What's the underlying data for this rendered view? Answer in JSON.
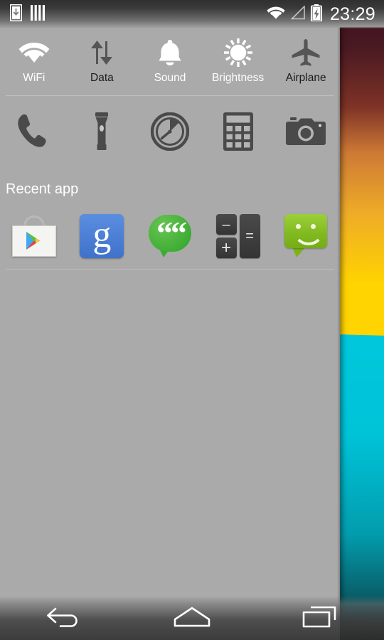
{
  "statusbar": {
    "left_icons": [
      {
        "name": "download-icon",
        "label": "Download"
      },
      {
        "name": "sim-card-icon",
        "label": "SIM"
      }
    ],
    "right_icons": [
      {
        "name": "wifi-icon",
        "label": "WiFi signal"
      },
      {
        "name": "cell-signal-icon",
        "label": "Mobile signal"
      },
      {
        "name": "battery-charging-icon",
        "label": "Battery charging"
      }
    ],
    "clock": "23:29"
  },
  "toggles": [
    {
      "label": "WiFi",
      "icon": "wifi-icon",
      "state": "on"
    },
    {
      "label": "Data",
      "icon": "data-sync-icon",
      "state": "off"
    },
    {
      "label": "Sound",
      "icon": "bell-icon",
      "state": "on"
    },
    {
      "label": "Brightness",
      "icon": "sun-icon",
      "state": "on"
    },
    {
      "label": "Airplane",
      "icon": "airplane-icon",
      "state": "off"
    }
  ],
  "shortcuts": [
    {
      "label": "Phone",
      "icon": "phone-icon"
    },
    {
      "label": "Flashlight",
      "icon": "flashlight-icon"
    },
    {
      "label": "Timer",
      "icon": "timer-icon"
    },
    {
      "label": "Calculator",
      "icon": "calculator-icon"
    },
    {
      "label": "Camera",
      "icon": "camera-icon"
    }
  ],
  "recent": {
    "title": "Recent app",
    "apps": [
      {
        "label": "Play Store",
        "icon": "play-store-icon"
      },
      {
        "label": "Google",
        "icon": "google-search-icon",
        "glyph": "g"
      },
      {
        "label": "Hangouts",
        "icon": "hangouts-icon",
        "glyph_left": "“",
        "glyph_right": "“"
      },
      {
        "label": "Calculator",
        "icon": "calculator-app-icon",
        "key_minus": "–",
        "key_plus": "+",
        "key_equals": "="
      },
      {
        "label": "Messaging",
        "icon": "messaging-icon"
      }
    ]
  },
  "navbar": [
    {
      "label": "Back",
      "icon": "back-icon"
    },
    {
      "label": "Home",
      "icon": "home-icon"
    },
    {
      "label": "Recents",
      "icon": "recents-icon"
    }
  ],
  "colors": {
    "panel_bg": "#aaaaaa",
    "toggle_on": "#ffffff",
    "toggle_off": "#555555",
    "divider": "#bfbfbf",
    "wallpaper_top": "#3a1020",
    "wallpaper_mid": "#ffd400",
    "wallpaper_bottom": "#00c3d8"
  }
}
